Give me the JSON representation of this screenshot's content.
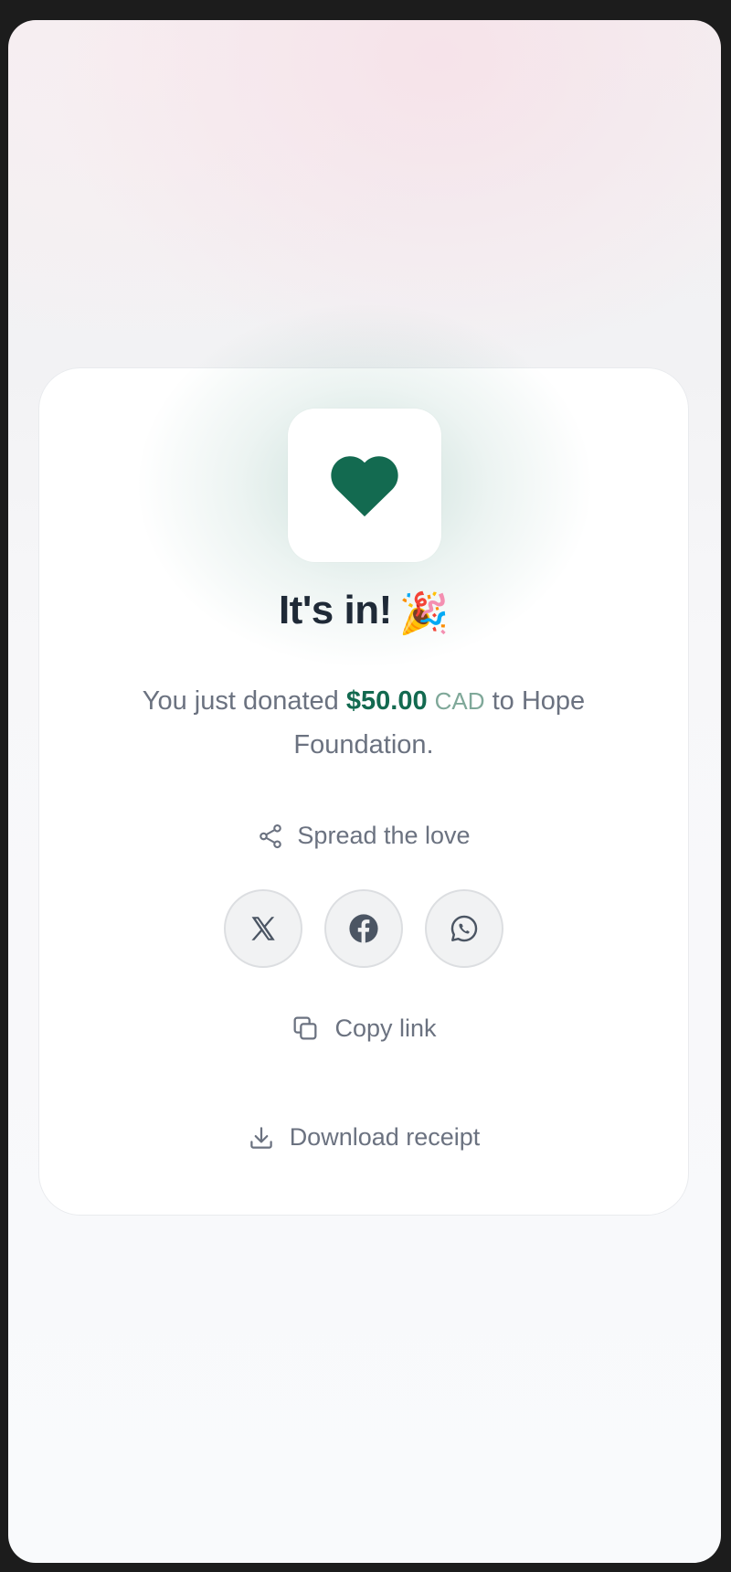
{
  "confirmation": {
    "title": "It's in!",
    "title_emoji": "🎉",
    "message_prefix": "You just donated ",
    "amount": "$50.00",
    "currency": "CAD",
    "message_suffix": " to Hope Foundation.",
    "heart_icon": "heart-icon",
    "accent_color": "#136a50"
  },
  "share": {
    "label": "Spread the love",
    "icon": "share-icon",
    "buttons": [
      {
        "icon": "x-logo-icon"
      },
      {
        "icon": "facebook-icon"
      },
      {
        "icon": "whatsapp-icon"
      }
    ]
  },
  "copy_link": {
    "label": "Copy link",
    "icon": "copy-icon"
  },
  "download_receipt": {
    "label": "Download receipt",
    "icon": "download-icon"
  }
}
